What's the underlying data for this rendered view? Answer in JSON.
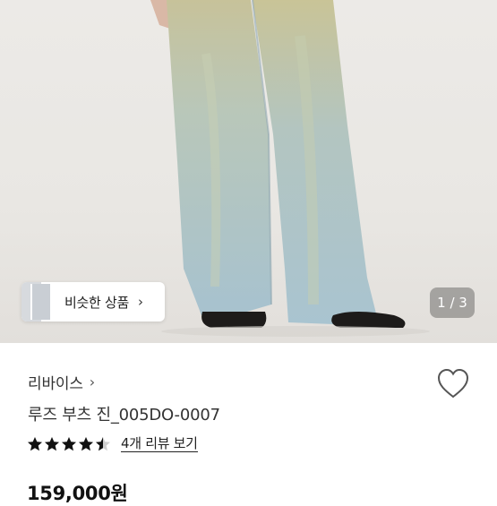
{
  "gallery": {
    "similar_label": "비슷한 상품",
    "chevron": "›",
    "pager": "1 / 3"
  },
  "product": {
    "brand": "리바이스",
    "brand_chevron": "›",
    "title": "루즈 부츠 진_005DO-0007",
    "rating": 4.5,
    "review_link": "4개 리뷰 보기",
    "price": "159,000원"
  },
  "colors": {
    "denim": "#a9c3cc",
    "star": "#111111",
    "pager_bg": "rgba(0,0,0,0.28)"
  }
}
